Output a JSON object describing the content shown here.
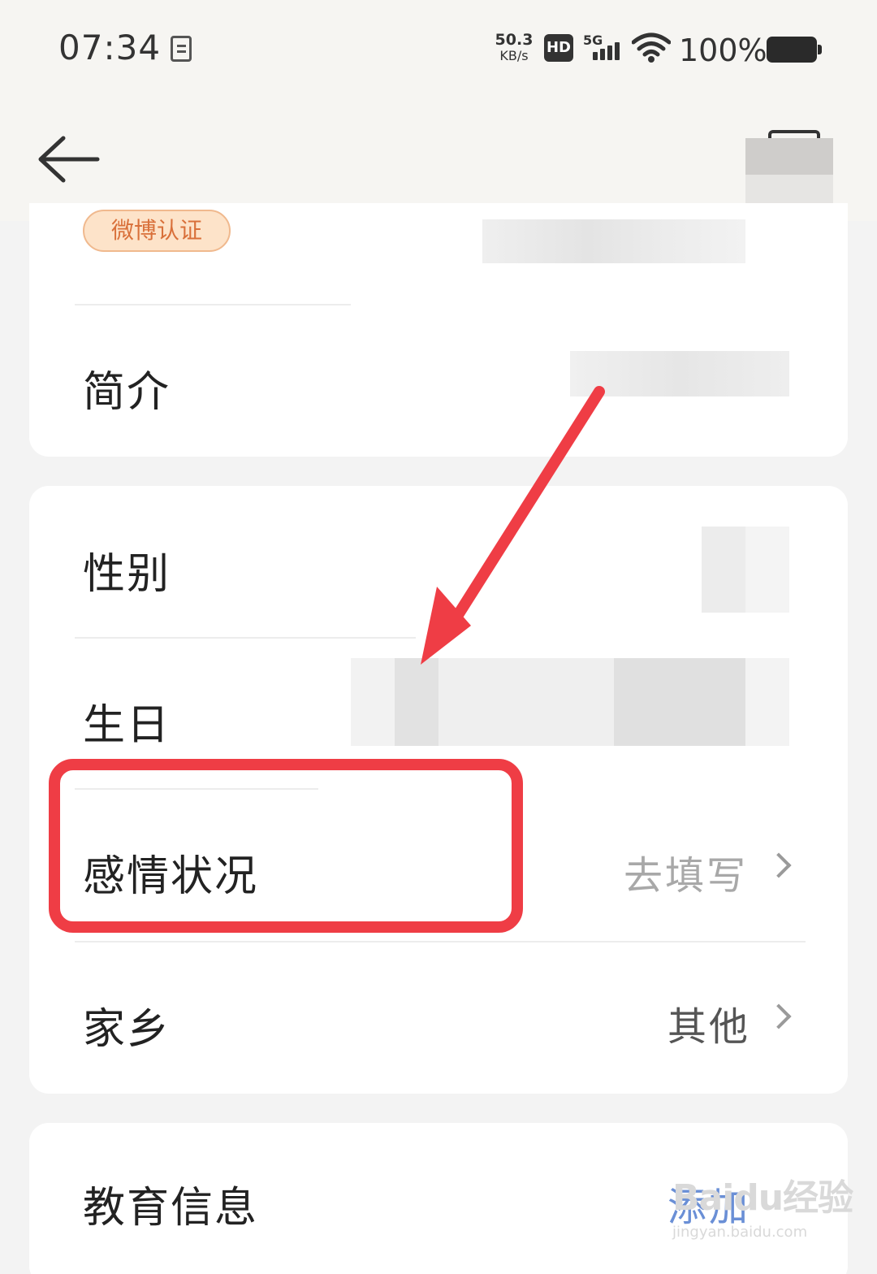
{
  "status_bar": {
    "time": "07:34",
    "net_speed_value": "50.3",
    "net_speed_unit": "KB/s",
    "hd_label": "HD",
    "network_type": "5G",
    "battery": "100%"
  },
  "profile": {
    "weibo_badge": "微博认证",
    "rows": [
      {
        "label": "简介"
      },
      {
        "label": "性别"
      },
      {
        "label": "生日"
      },
      {
        "label": "感情状况",
        "value": "去填写"
      },
      {
        "label": "家乡",
        "value": "其他"
      }
    ],
    "education": {
      "label": "教育信息",
      "action": "添加"
    }
  },
  "watermark": {
    "brand": "Baidu经验",
    "site": "jingyan.baidu.com"
  },
  "colors": {
    "highlight": "#ef3d45",
    "badge_bg": "#fde3c9",
    "badge_text": "#d9703a",
    "link_blue": "#6a8fd6"
  }
}
